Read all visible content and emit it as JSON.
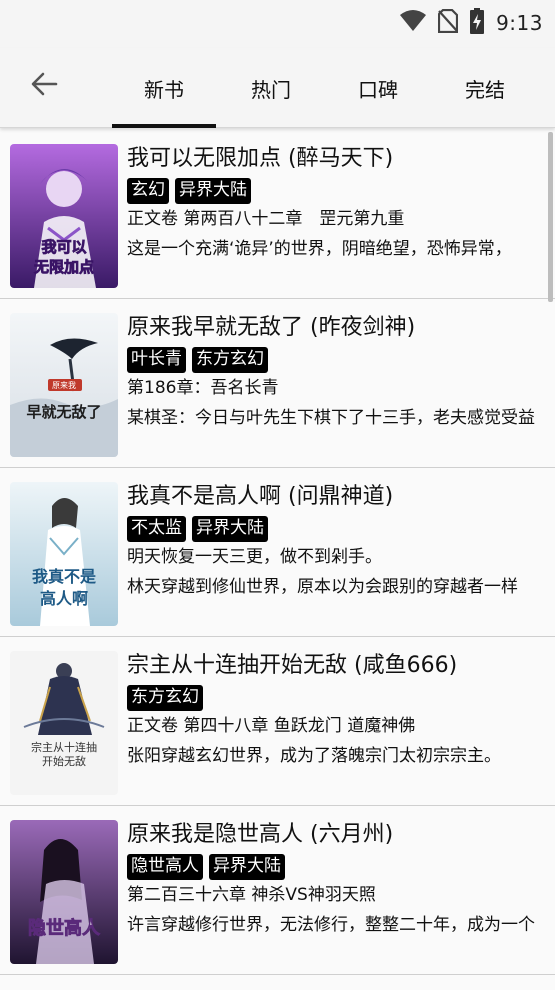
{
  "status_bar": {
    "time": "9:13",
    "icons": [
      "wifi-icon",
      "no-sim-icon",
      "battery-charging-icon"
    ]
  },
  "app_bar": {
    "back_icon": "arrow-left-icon",
    "tabs": [
      {
        "label": "新书",
        "active": true
      },
      {
        "label": "热门",
        "active": false
      },
      {
        "label": "口碑",
        "active": false
      },
      {
        "label": "完结",
        "active": false
      }
    ]
  },
  "books": [
    {
      "title": "我可以无限加点 (醉马天下)",
      "tags": [
        "玄幻",
        "异界大陆"
      ],
      "chapter": "正文卷 第两百八十二章　罡元第九重",
      "desc": "这是一个充满‘诡异’的世界，阴暗绝望，恐怖异常，",
      "cover_text": "我可以无限加点",
      "cover_colors": [
        "#5a2d8a",
        "#c46ad8"
      ]
    },
    {
      "title": "原来我早就无敌了 (昨夜剑神)",
      "tags": [
        "叶长青",
        "东方玄幻"
      ],
      "chapter": "第186章：吾名长青",
      "desc": "某棋圣：今日与叶先生下棋下了十三手，老夫感觉受益",
      "cover_text": "早就无敌了",
      "cover_colors": [
        "#e9eef2",
        "#b8c4cf"
      ]
    },
    {
      "title": "我真不是高人啊 (问鼎神道)",
      "tags": [
        "不太监",
        "异界大陆"
      ],
      "chapter": "明天恢复一天三更，做不到剁手。",
      "desc": "林天穿越到修仙世界，原本以为会跟别的穿越者一样",
      "cover_text": "我真不是高人啊",
      "cover_colors": [
        "#dce9f0",
        "#9fc2d4"
      ]
    },
    {
      "title": "宗主从十连抽开始无敌 (咸鱼666)",
      "tags": [
        "东方玄幻"
      ],
      "chapter": "正文卷 第四十八章 鱼跃龙门 道魔神佛",
      "desc": "张阳穿越玄幻世界，成为了落魄宗门太初宗宗主。",
      "cover_text": "宗主从十连抽开始无敌",
      "cover_colors": [
        "#f2f2f2",
        "#c9cfd6"
      ]
    },
    {
      "title": "原来我是隐世高人 (六月州)",
      "tags": [
        "隐世高人",
        "异界大陆"
      ],
      "chapter": "第二百三十六章 神杀VS神羽天照",
      "desc": "许言穿越修行世界，无法修行，整整二十年，成为一个",
      "cover_text": "隐世高人",
      "cover_colors": [
        "#2a1c3a",
        "#8a5aa6"
      ]
    }
  ]
}
